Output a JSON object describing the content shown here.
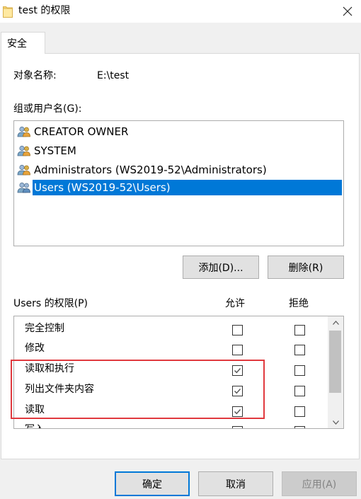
{
  "window": {
    "title": "test 的权限"
  },
  "tabs": [
    {
      "label": "安全"
    }
  ],
  "object": {
    "label": "对象名称:",
    "value": "E:\\test"
  },
  "groups": {
    "label": "组或用户名(G):",
    "items": [
      {
        "label": "CREATOR OWNER",
        "selected": false
      },
      {
        "label": "SYSTEM",
        "selected": false
      },
      {
        "label": "Administrators (WS2019-52\\Administrators)",
        "selected": false
      },
      {
        "label": "Users (WS2019-52\\Users)",
        "selected": true
      }
    ],
    "add_label": "添加(D)...",
    "remove_label": "删除(R)"
  },
  "permissions": {
    "label": "Users 的权限(P)",
    "allow_label": "允许",
    "deny_label": "拒绝",
    "rows": [
      {
        "name": "完全控制",
        "allow": false,
        "deny": false
      },
      {
        "name": "修改",
        "allow": false,
        "deny": false
      },
      {
        "name": "读取和执行",
        "allow": true,
        "deny": false
      },
      {
        "name": "列出文件夹内容",
        "allow": true,
        "deny": false
      },
      {
        "name": "读取",
        "allow": true,
        "deny": false
      },
      {
        "name": "写入",
        "allow": false,
        "deny": false
      }
    ]
  },
  "footer": {
    "ok_label": "确定",
    "cancel_label": "取消",
    "apply_label": "应用(A)"
  },
  "colors": {
    "selection": "#0078d7",
    "highlight": "#e0393e",
    "ok_border": "#0078d7"
  }
}
